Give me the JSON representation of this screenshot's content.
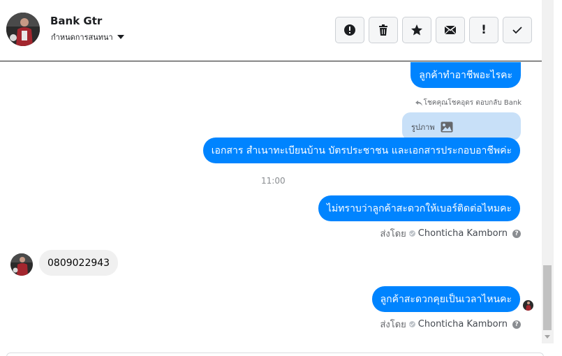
{
  "header": {
    "contact_name": "Bank Gtr",
    "assign_label": "กำหนดการสนทนา",
    "actions": [
      {
        "name": "mark-spam-button",
        "icon": "alert-circle-icon"
      },
      {
        "name": "delete-button",
        "icon": "trash-icon"
      },
      {
        "name": "star-button",
        "icon": "star-icon"
      },
      {
        "name": "mark-unread-button",
        "icon": "envelope-icon"
      },
      {
        "name": "follow-up-button",
        "icon": "exclamation-icon",
        "text": "!"
      },
      {
        "name": "mark-done-button",
        "icon": "check-icon"
      }
    ]
  },
  "messages": {
    "m1": "ลูกค้าทำอาชีพอะไรคะ",
    "reply_label": "โชคคุณโชคอุดร ตอบกลับ Bank",
    "photo_label": "รูปภาพ",
    "m2": "เอกสาร สำเนาทะเบียนบ้าน บัตรประชาชน และเอกสารประกอบอาชีพค่ะ",
    "time": "11:00",
    "m3": "ไม่ทราบว่าลูกค้าสะดวกให้เบอร์ติดต่อไหมคะ",
    "sent_by_label": "ส่งโดย",
    "agent_name": "Chonticha Kamborn",
    "help": "?",
    "m4": "0809022943",
    "m5": "ลูกค้าสะดวกคุยเป็นเวลาไหนคะ"
  },
  "colors": {
    "outgoing_bubble": "#0084ff",
    "incoming_bubble": "#f0f0f0",
    "photo_bubble": "#c8e0f8"
  }
}
